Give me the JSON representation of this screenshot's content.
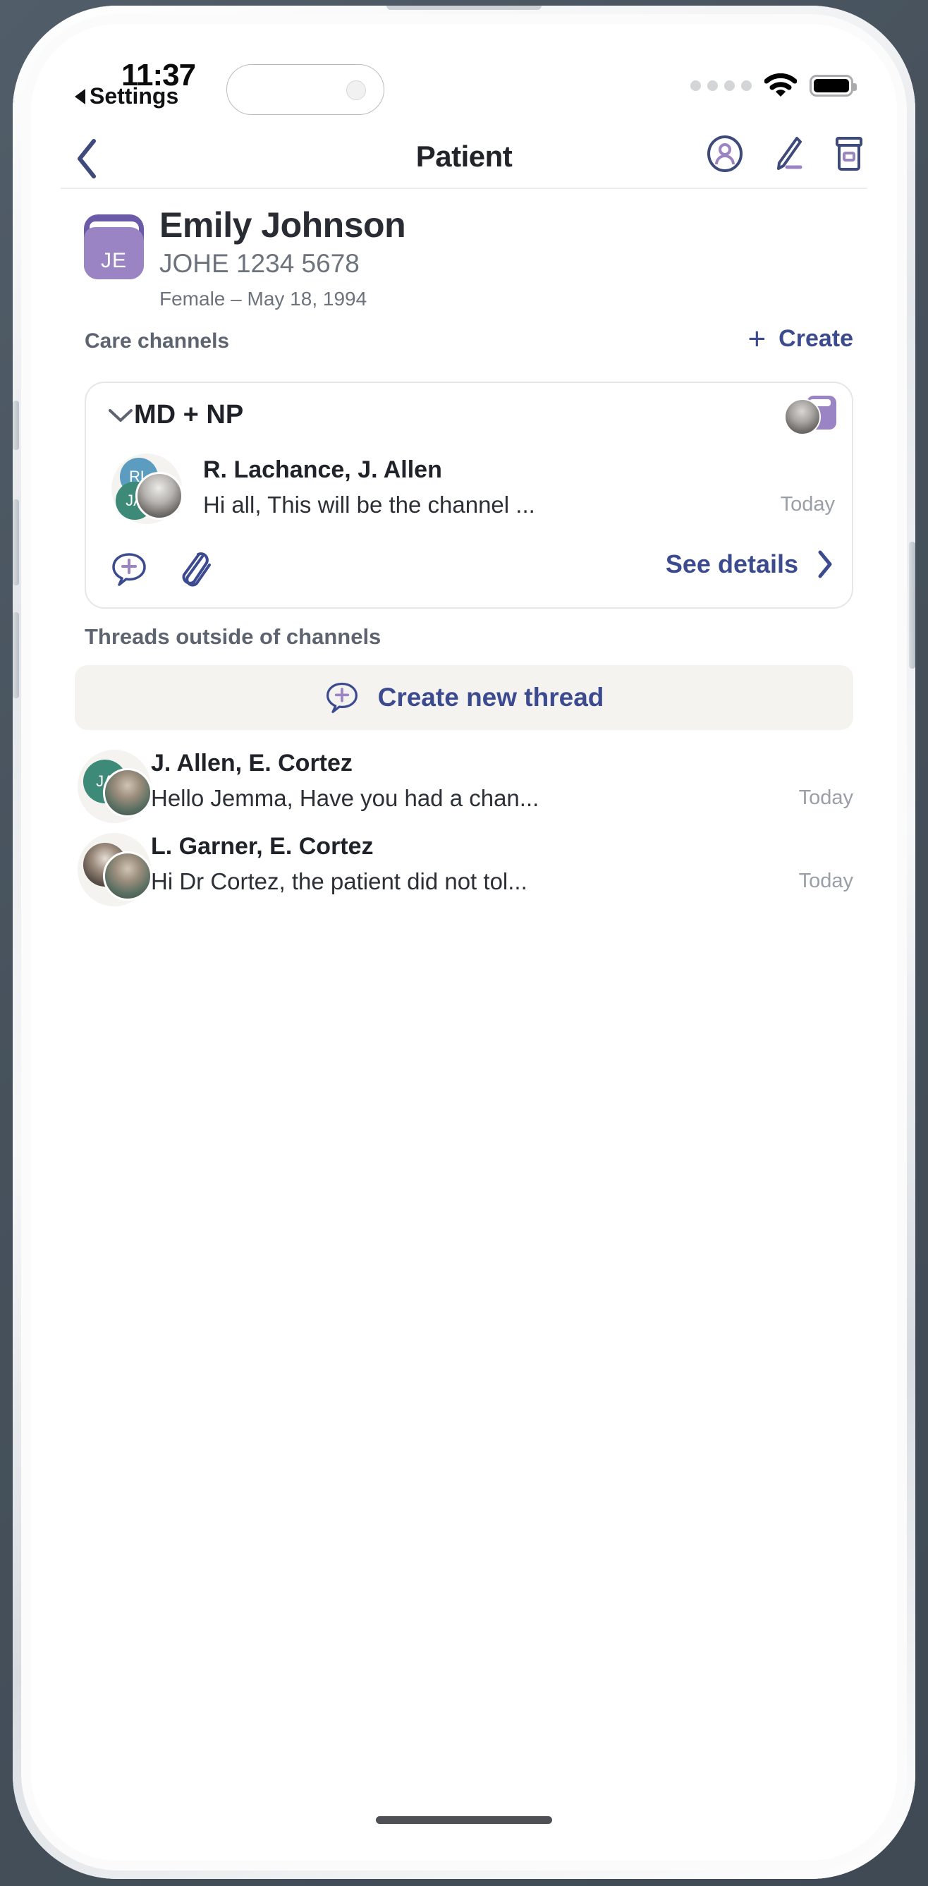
{
  "status_bar": {
    "time": "11:37",
    "back_label": "Settings",
    "signal_dots": 4,
    "wifi_icon": "wifi-icon",
    "battery_icon": "battery-full-icon"
  },
  "nav": {
    "back_icon": "chevron-left-icon",
    "title": "Patient",
    "actions": [
      {
        "icon": "person-circle-icon",
        "name": "patient-profile-button"
      },
      {
        "icon": "pencil-edit-icon",
        "name": "edit-button"
      },
      {
        "icon": "pill-bottle-icon",
        "name": "medication-button"
      }
    ]
  },
  "patient": {
    "avatar_initials": "JE",
    "avatar_icon": "patient-folder-avatar",
    "name": "Emily Johnson",
    "mrn": "JOHE 1234 5678",
    "demographics": "Female  –  May 18, 1994"
  },
  "care_channels": {
    "section_title": "Care channels",
    "create_label": "Create",
    "create_icon": "plus-icon",
    "cards": [
      {
        "expand_icon": "chevron-down-icon",
        "title": "MD + NP",
        "threads": [
          {
            "participants": "R. Lachance, J. Allen",
            "preview": "Hi all, This will be the channel ...",
            "time": "Today",
            "avatars": [
              "RL",
              "JA",
              "photo"
            ]
          }
        ],
        "actions": {
          "new_message_icon": "chat-plus-icon",
          "attachment_icon": "paperclip-icon",
          "details_label": "See details",
          "details_chevron": "chevron-right-icon"
        }
      }
    ]
  },
  "threads_outside": {
    "section_title": "Threads outside of channels",
    "create_thread_label": "Create new thread",
    "create_thread_icon": "chat-plus-icon",
    "items": [
      {
        "participants": "J. Allen, E. Cortez",
        "preview": "Hello Jemma, Have you had a chan...",
        "time": "Today",
        "avatar_initials": "JA"
      },
      {
        "participants": "L. Garner, E. Cortez",
        "preview": "Hi Dr Cortez, the patient did not tol...",
        "time": "Today",
        "avatar_initials": ""
      }
    ]
  },
  "colors": {
    "navy": "#3c4a8f",
    "purple": "#9b84c4",
    "purple_dark": "#6b5aa8",
    "gray_text": "#6d737c",
    "muted": "#9a9ea6",
    "card_border": "#e9e6e3",
    "button_bg": "#f5f3f0"
  }
}
